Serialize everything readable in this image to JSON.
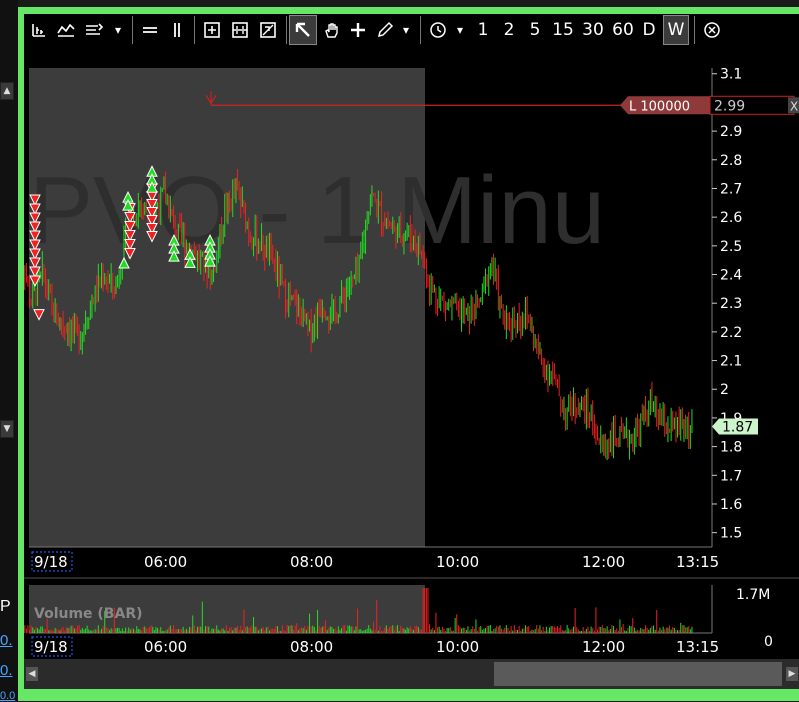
{
  "left_strip": {
    "up_arrow": "▲",
    "down_arrow": "▼",
    "label": "P",
    "links": [
      "0.",
      "0.",
      "0.0"
    ]
  },
  "toolbar": {
    "intervals": [
      "1",
      "2",
      "5",
      "15",
      "30",
      "60",
      "D",
      "W"
    ],
    "dropdown": "▾"
  },
  "chart": {
    "watermark": "PVO - 1 Minu",
    "order_line_label": "L 100000",
    "order_line_close": "X",
    "last_price_label": "1.87",
    "volume_label": "Volume (BAR)",
    "volume_max_label": "1.7M",
    "volume_min_label": "0",
    "colors": {
      "up": "#22dd22",
      "down": "#ee2222",
      "premarket_bg": "#3c3c3c",
      "order_line": "#cc2222",
      "last_price_bg": "#ccf5cc"
    }
  },
  "chart_data": {
    "type": "candlestick",
    "y_ticks": [
      "3.1",
      "3",
      "2.9",
      "2.8",
      "2.7",
      "2.6",
      "2.5",
      "2.4",
      "2.3",
      "2.2",
      "2.1",
      "2",
      "1.9",
      "1.8",
      "1.7",
      "1.6",
      "1.5"
    ],
    "x_ticks": [
      "9/18",
      "06:00",
      "08:00",
      "10:00",
      "12:00",
      "13:15"
    ],
    "ylim": [
      1.45,
      3.12
    ],
    "order_line_price": 2.99,
    "last_price": 1.87,
    "price_path": [
      {
        "t": "04:00",
        "p": 2.55
      },
      {
        "t": "04:10",
        "p": 2.3
      },
      {
        "t": "04:20",
        "p": 2.4
      },
      {
        "t": "04:30",
        "p": 2.25
      },
      {
        "t": "04:40",
        "p": 2.22
      },
      {
        "t": "04:50",
        "p": 2.18
      },
      {
        "t": "05:00",
        "p": 2.3
      },
      {
        "t": "05:10",
        "p": 2.4
      },
      {
        "t": "05:20",
        "p": 2.35
      },
      {
        "t": "05:30",
        "p": 2.55
      },
      {
        "t": "05:40",
        "p": 2.65
      },
      {
        "t": "05:50",
        "p": 2.6
      },
      {
        "t": "06:00",
        "p": 2.68
      },
      {
        "t": "06:10",
        "p": 2.55
      },
      {
        "t": "06:20",
        "p": 2.5
      },
      {
        "t": "06:30",
        "p": 2.45
      },
      {
        "t": "06:40",
        "p": 2.4
      },
      {
        "t": "06:50",
        "p": 2.62
      },
      {
        "t": "07:00",
        "p": 2.7
      },
      {
        "t": "07:10",
        "p": 2.55
      },
      {
        "t": "07:20",
        "p": 2.5
      },
      {
        "t": "07:30",
        "p": 2.45
      },
      {
        "t": "07:40",
        "p": 2.32
      },
      {
        "t": "07:50",
        "p": 2.28
      },
      {
        "t": "08:00",
        "p": 2.2
      },
      {
        "t": "08:10",
        "p": 2.3
      },
      {
        "t": "08:20",
        "p": 2.25
      },
      {
        "t": "08:30",
        "p": 2.35
      },
      {
        "t": "08:40",
        "p": 2.4
      },
      {
        "t": "08:50",
        "p": 2.68
      },
      {
        "t": "09:00",
        "p": 2.6
      },
      {
        "t": "09:10",
        "p": 2.55
      },
      {
        "t": "09:20",
        "p": 2.55
      },
      {
        "t": "09:30",
        "p": 2.5
      },
      {
        "t": "09:40",
        "p": 2.35
      },
      {
        "t": "09:50",
        "p": 2.3
      },
      {
        "t": "10:00",
        "p": 2.28
      },
      {
        "t": "10:10",
        "p": 2.25
      },
      {
        "t": "10:20",
        "p": 2.3
      },
      {
        "t": "10:30",
        "p": 2.45
      },
      {
        "t": "10:40",
        "p": 2.22
      },
      {
        "t": "10:50",
        "p": 2.25
      },
      {
        "t": "11:00",
        "p": 2.25
      },
      {
        "t": "11:10",
        "p": 2.1
      },
      {
        "t": "11:20",
        "p": 2.05
      },
      {
        "t": "11:30",
        "p": 1.92
      },
      {
        "t": "11:40",
        "p": 1.95
      },
      {
        "t": "11:50",
        "p": 1.92
      },
      {
        "t": "12:00",
        "p": 1.8
      },
      {
        "t": "12:10",
        "p": 1.83
      },
      {
        "t": "12:20",
        "p": 1.82
      },
      {
        "t": "12:30",
        "p": 1.85
      },
      {
        "t": "12:40",
        "p": 1.95
      },
      {
        "t": "12:50",
        "p": 1.88
      },
      {
        "t": "13:00",
        "p": 1.86
      },
      {
        "t": "13:10",
        "p": 1.87
      },
      {
        "t": "13:15",
        "p": 1.87
      }
    ]
  }
}
